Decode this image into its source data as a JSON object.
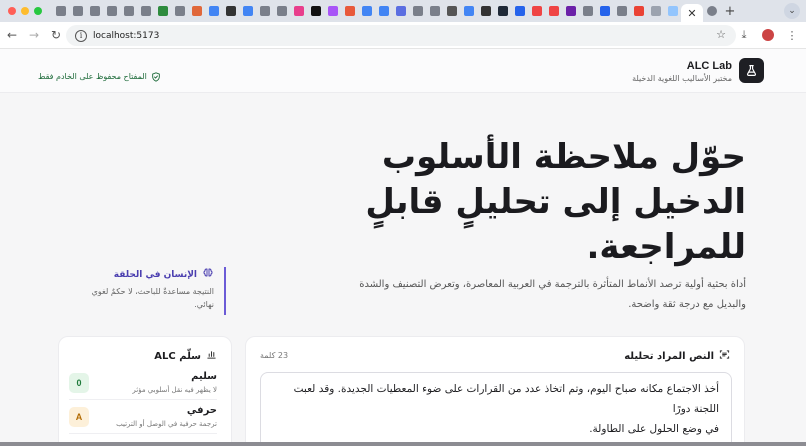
{
  "browser": {
    "url": "localhost:5173",
    "active_tab_close": "✕",
    "new_tab": "+",
    "favicon_colors": [
      "#7a7f8a",
      "#7a7f8a",
      "#7a7f8a",
      "#7a7f8a",
      "#7a7f8a",
      "#7a7f8a",
      "#2e8b3e",
      "#7a7f8a",
      "#e0673a",
      "#4285f4",
      "#333333",
      "#4285f4",
      "#7a7f8a",
      "#7a7f8a",
      "#e83e8c",
      "#111111",
      "#a855f7",
      "#e8593a",
      "#4285f4",
      "#4285f4",
      "#5b6ee1",
      "#7a7f8a",
      "#7a7f8a",
      "#555555",
      "#4285f4",
      "#333333",
      "#1f2937",
      "#2563eb",
      "#ef4444",
      "#ef4444",
      "#6b21a8",
      "#7a7f8a",
      "#2563eb",
      "#7a7f8a",
      "#ea4335",
      "#9ca3af",
      "#93c5fd"
    ]
  },
  "header": {
    "brand_title": "ALC Lab",
    "brand_subtitle": "مختبر الأساليب اللغوية الدخيلة",
    "key_notice": "المفتاح محفوظ على الخادم فقط"
  },
  "hero": {
    "title_line1": "حوّل ملاحظة الأسلوب",
    "title_line2": "الدخيل إلى تحليلٍ قابلٍ",
    "title_line3": "للمراجعة.",
    "lead_line1": "أداة بحثية أولية ترصد الأنماط المتأثرة بالترجمة في العربية المعاصرة، وتعرض التصنيف والشدة",
    "lead_line2": "والبديل مع درجة ثقة واضحة."
  },
  "human_loop": {
    "heading": "الإنسان في الحلقة",
    "desc_line1": "النتيجة مساعدةٌ للباحث، لا حكمٌ لغوي",
    "desc_line2": "نهائي."
  },
  "scale_card": {
    "title": "سلّم ALC",
    "levels": [
      {
        "badge": "0",
        "name": "سليم",
        "desc": "لا يظهر فيه نقل أسلوبي مؤثر",
        "badge_bg": "#e4f5e8",
        "badge_fg": "#1e7a3a"
      },
      {
        "badge": "A",
        "name": "حرفي",
        "desc": "ترجمة حرفية في الوصل أو الترتيب",
        "badge_bg": "#fdf0d9",
        "badge_fg": "#b26a00"
      }
    ]
  },
  "input_card": {
    "title": "النص المراد تحليله",
    "word_count": "23 كلمة",
    "text_line1": "أخذ الاجتماع مكانه صباح اليوم، وتم اتخاذ عدد من القرارات على ضوء المعطيات الجديدة. وقد لعبت اللجنة دورًا",
    "text_line2": "في وضع الحلول على الطاولة."
  }
}
